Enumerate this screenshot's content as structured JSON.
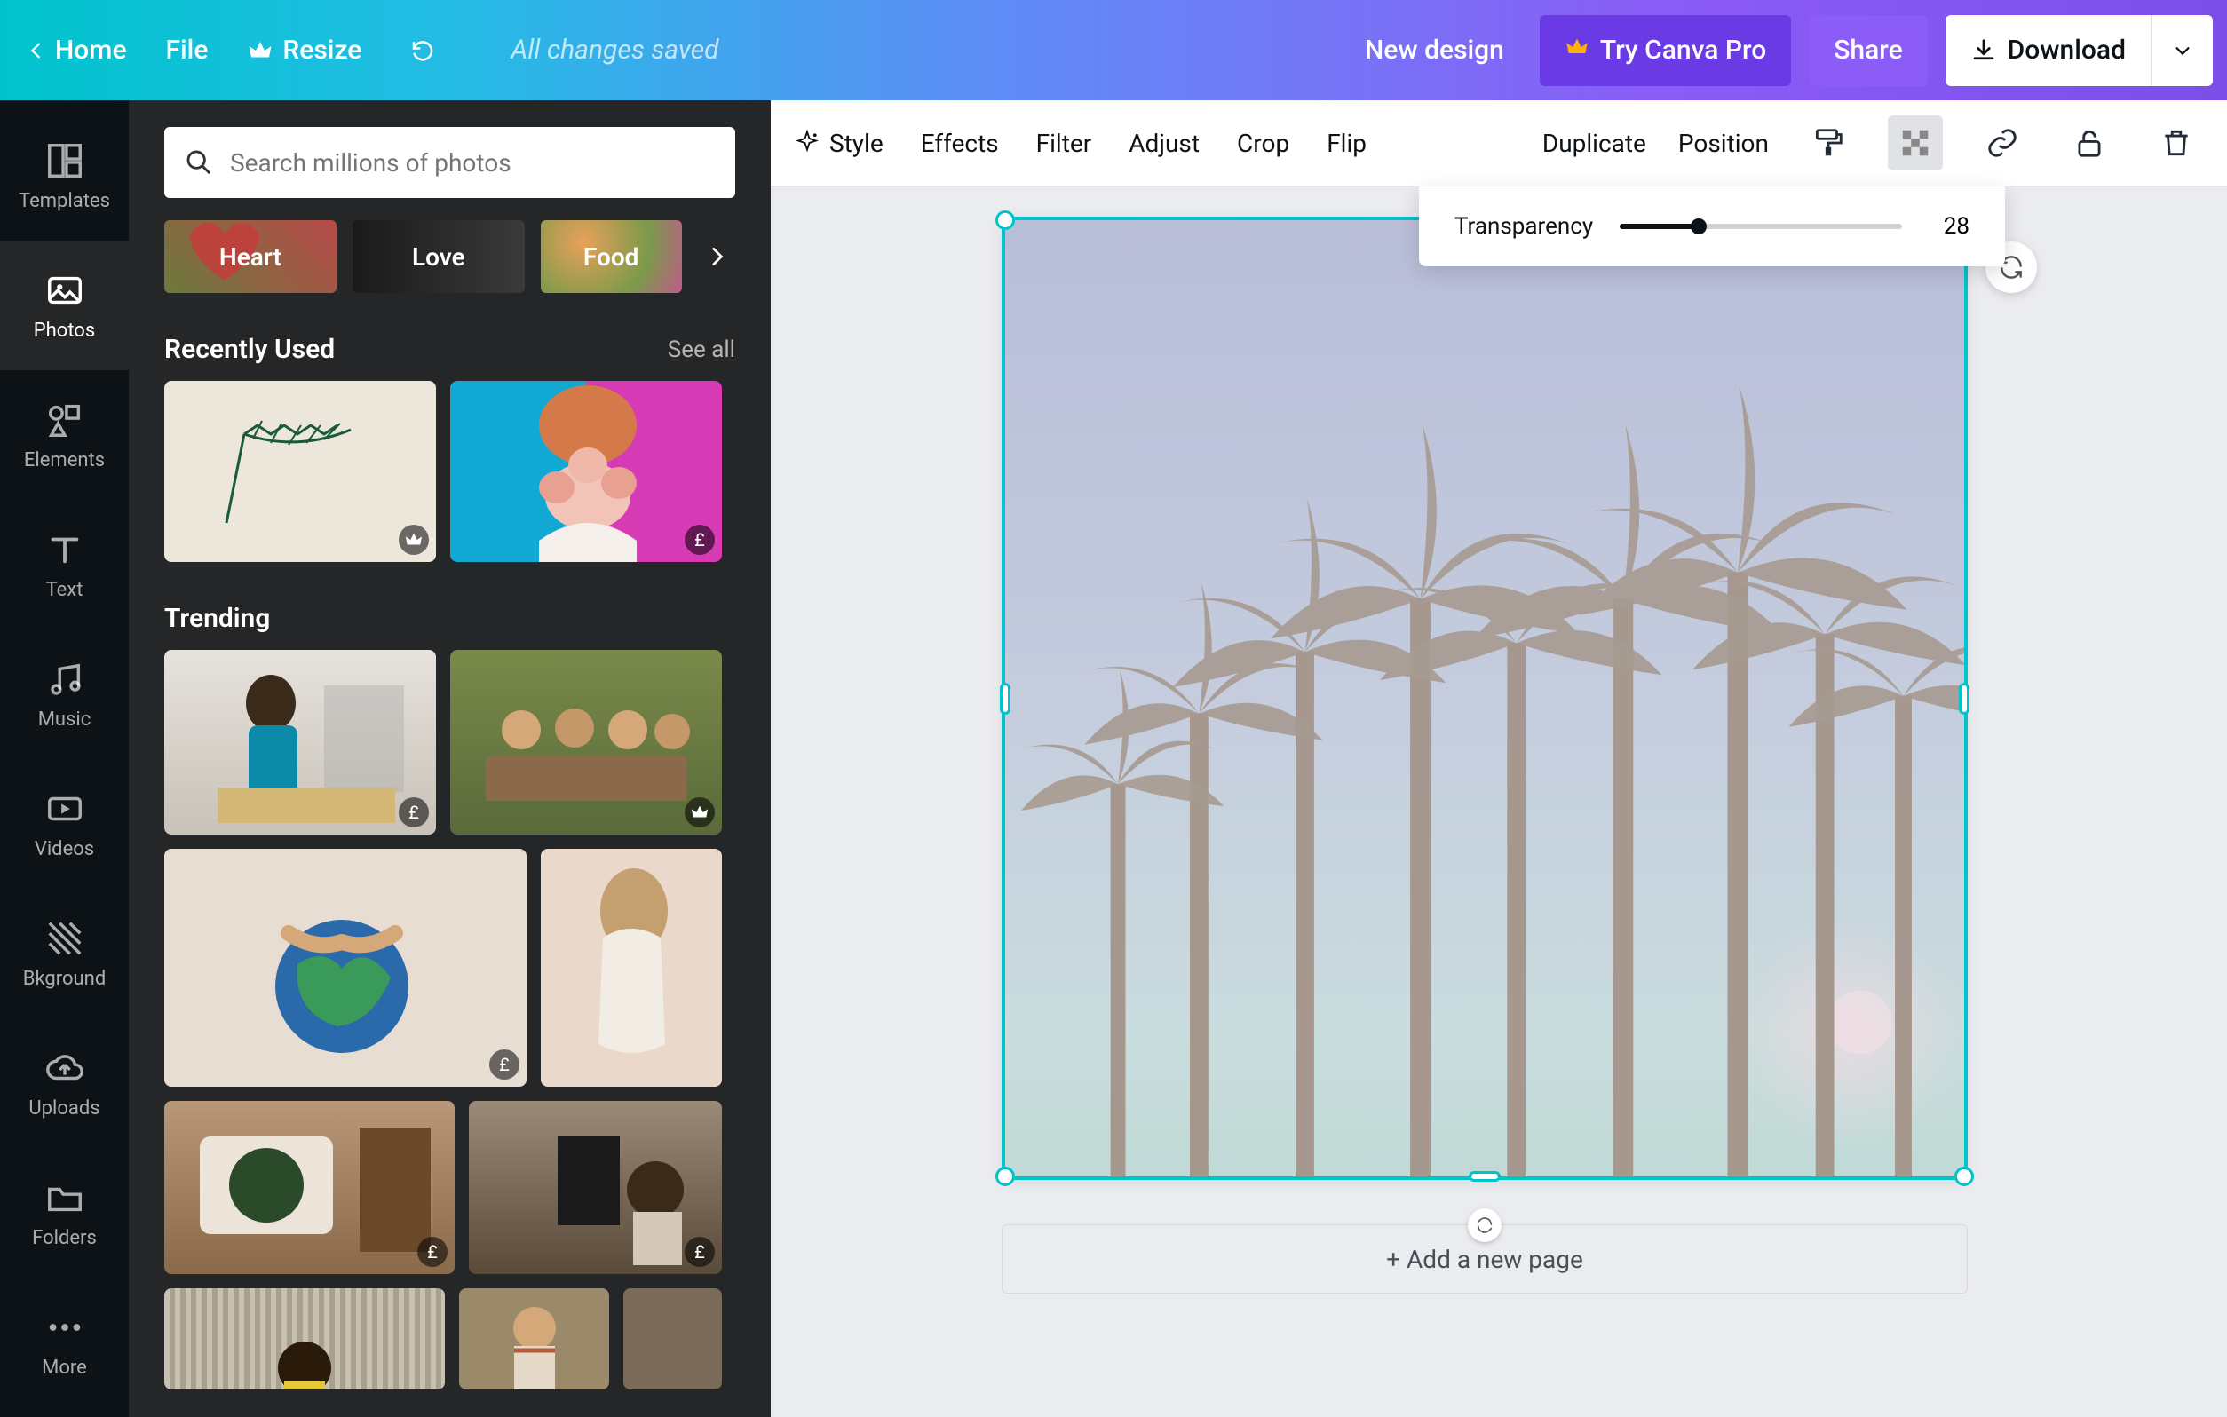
{
  "topbar": {
    "home": "Home",
    "file": "File",
    "resize": "Resize",
    "status": "All changes saved",
    "new_design": "New design",
    "try_pro": "Try Canva Pro",
    "share": "Share",
    "download": "Download"
  },
  "rail": {
    "templates": "Templates",
    "photos": "Photos",
    "elements": "Elements",
    "text": "Text",
    "music": "Music",
    "videos": "Videos",
    "background": "Bkground",
    "uploads": "Uploads",
    "folders": "Folders",
    "more": "More"
  },
  "panel": {
    "search_placeholder": "Search millions of photos",
    "categories": [
      "Heart",
      "Love",
      "Food"
    ],
    "recently_used_title": "Recently Used",
    "see_all": "See all",
    "trending_title": "Trending",
    "price_symbol": "£"
  },
  "contextbar": {
    "style": "Style",
    "effects": "Effects",
    "filter": "Filter",
    "adjust": "Adjust",
    "crop": "Crop",
    "flip": "Flip",
    "duplicate": "Duplicate",
    "position": "Position"
  },
  "transparency": {
    "label": "Transparency",
    "value": "28",
    "percent": 28
  },
  "canvas": {
    "add_page": "+ Add a new page"
  }
}
